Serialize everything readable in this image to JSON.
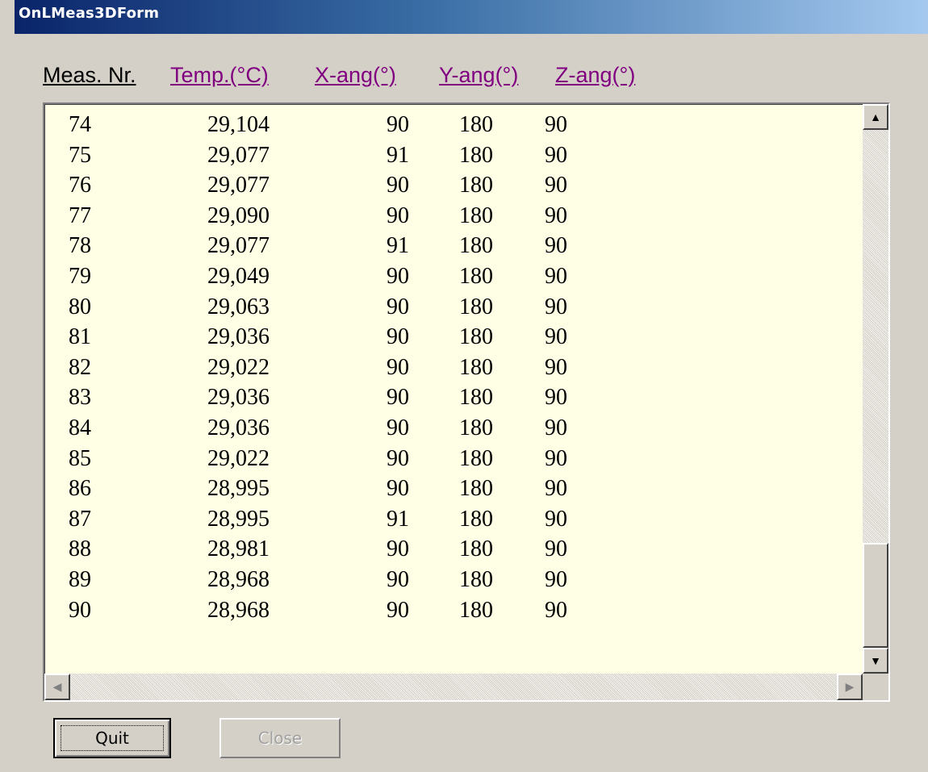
{
  "window": {
    "title": "OnLMeas3DForm"
  },
  "columns": {
    "meas_nr": "Meas. Nr.",
    "temp": "Temp.(°C)",
    "x_ang": "X-ang(°)",
    "y_ang": "Y-ang(°)",
    "z_ang": "Z-ang(°)"
  },
  "rows": [
    {
      "nr": "74",
      "temp": "29,104",
      "x": "90",
      "y": "180",
      "z": "90"
    },
    {
      "nr": "75",
      "temp": "29,077",
      "x": "91",
      "y": "180",
      "z": "90"
    },
    {
      "nr": "76",
      "temp": "29,077",
      "x": "90",
      "y": "180",
      "z": "90"
    },
    {
      "nr": "77",
      "temp": "29,090",
      "x": "90",
      "y": "180",
      "z": "90"
    },
    {
      "nr": "78",
      "temp": "29,077",
      "x": "91",
      "y": "180",
      "z": "90"
    },
    {
      "nr": "79",
      "temp": "29,049",
      "x": "90",
      "y": "180",
      "z": "90"
    },
    {
      "nr": "80",
      "temp": "29,063",
      "x": "90",
      "y": "180",
      "z": "90"
    },
    {
      "nr": "81",
      "temp": "29,036",
      "x": "90",
      "y": "180",
      "z": "90"
    },
    {
      "nr": "82",
      "temp": "29,022",
      "x": "90",
      "y": "180",
      "z": "90"
    },
    {
      "nr": "83",
      "temp": "29,036",
      "x": "90",
      "y": "180",
      "z": "90"
    },
    {
      "nr": "84",
      "temp": "29,036",
      "x": "90",
      "y": "180",
      "z": "90"
    },
    {
      "nr": "85",
      "temp": "29,022",
      "x": "90",
      "y": "180",
      "z": "90"
    },
    {
      "nr": "86",
      "temp": "28,995",
      "x": "90",
      "y": "180",
      "z": "90"
    },
    {
      "nr": "87",
      "temp": "28,995",
      "x": "91",
      "y": "180",
      "z": "90"
    },
    {
      "nr": "88",
      "temp": "28,981",
      "x": "90",
      "y": "180",
      "z": "90"
    },
    {
      "nr": "89",
      "temp": "28,968",
      "x": "90",
      "y": "180",
      "z": "90"
    },
    {
      "nr": "90",
      "temp": "28,968",
      "x": "90",
      "y": "180",
      "z": "90"
    }
  ],
  "buttons": {
    "quit": "Quit",
    "close": "Close"
  },
  "icons": {
    "scroll_up": "arrow-up-icon",
    "scroll_down": "arrow-down-icon",
    "scroll_left": "arrow-left-icon",
    "scroll_right": "arrow-right-icon"
  },
  "colors": {
    "title_gradient_start": "#0a246a",
    "title_gradient_end": "#a6caf0",
    "list_background": "#ffffe6",
    "link_header": "#800080",
    "face": "#d4d0c8"
  }
}
